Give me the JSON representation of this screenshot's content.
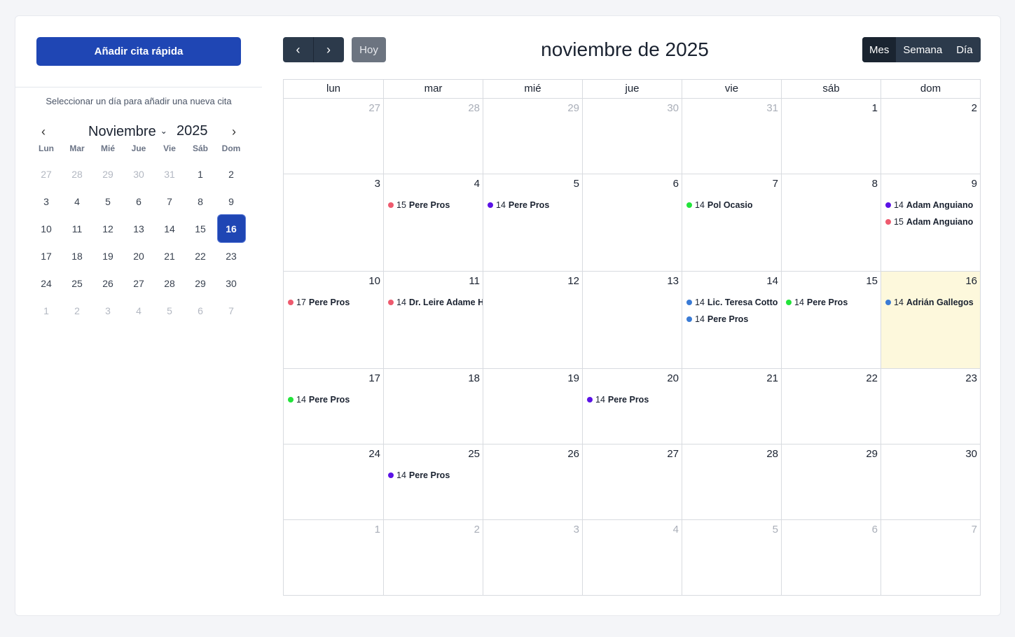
{
  "sidebar": {
    "quick_add_label": "Añadir cita rápida",
    "hint": "Seleccionar un día para añadir una nueva cita",
    "mini_calendar": {
      "month": "Noviembre",
      "year": "2025",
      "prev_icon": "chevron-left-icon",
      "next_icon": "chevron-right-icon",
      "weekdays": [
        "Lun",
        "Mar",
        "Mié",
        "Jue",
        "Vie",
        "Sáb",
        "Dom"
      ],
      "selected_day": "16",
      "days": [
        {
          "d": "27",
          "muted": true
        },
        {
          "d": "28",
          "muted": true
        },
        {
          "d": "29",
          "muted": true
        },
        {
          "d": "30",
          "muted": true
        },
        {
          "d": "31",
          "muted": true
        },
        {
          "d": "1"
        },
        {
          "d": "2"
        },
        {
          "d": "3"
        },
        {
          "d": "4"
        },
        {
          "d": "5"
        },
        {
          "d": "6"
        },
        {
          "d": "7"
        },
        {
          "d": "8"
        },
        {
          "d": "9"
        },
        {
          "d": "10"
        },
        {
          "d": "11"
        },
        {
          "d": "12"
        },
        {
          "d": "13"
        },
        {
          "d": "14"
        },
        {
          "d": "15"
        },
        {
          "d": "16",
          "selected": true
        },
        {
          "d": "17"
        },
        {
          "d": "18"
        },
        {
          "d": "19"
        },
        {
          "d": "20"
        },
        {
          "d": "21"
        },
        {
          "d": "22"
        },
        {
          "d": "23"
        },
        {
          "d": "24"
        },
        {
          "d": "25"
        },
        {
          "d": "26"
        },
        {
          "d": "27"
        },
        {
          "d": "28"
        },
        {
          "d": "29"
        },
        {
          "d": "30"
        },
        {
          "d": "1",
          "muted": true
        },
        {
          "d": "2",
          "muted": true
        },
        {
          "d": "3",
          "muted": true
        },
        {
          "d": "4",
          "muted": true
        },
        {
          "d": "5",
          "muted": true
        },
        {
          "d": "6",
          "muted": true
        },
        {
          "d": "7",
          "muted": true
        }
      ]
    }
  },
  "toolbar": {
    "prev_icon": "chevron-left-icon",
    "next_icon": "chevron-right-icon",
    "today_label": "Hoy",
    "title": "noviembre de 2025",
    "views": [
      {
        "label": "Mes",
        "active": true
      },
      {
        "label": "Semana"
      },
      {
        "label": "Día"
      }
    ]
  },
  "month": {
    "weekdays": [
      "lun",
      "mar",
      "mié",
      "jue",
      "vie",
      "sáb",
      "dom"
    ],
    "weeks": [
      [
        {
          "d": "27",
          "muted": true,
          "events": []
        },
        {
          "d": "28",
          "muted": true,
          "events": []
        },
        {
          "d": "29",
          "muted": true,
          "events": []
        },
        {
          "d": "30",
          "muted": true,
          "events": []
        },
        {
          "d": "31",
          "muted": true,
          "events": []
        },
        {
          "d": "1",
          "events": []
        },
        {
          "d": "2",
          "events": []
        }
      ],
      [
        {
          "d": "3",
          "events": []
        },
        {
          "d": "4",
          "events": [
            {
              "time": "15",
              "name": "Pere Pros",
              "color": "#ee5a6e"
            }
          ]
        },
        {
          "d": "5",
          "events": [
            {
              "time": "14",
              "name": "Pere Pros",
              "color": "#5b12e6"
            }
          ]
        },
        {
          "d": "6",
          "events": []
        },
        {
          "d": "7",
          "events": [
            {
              "time": "14",
              "name": "Pol Ocasio",
              "color": "#22e43a"
            }
          ]
        },
        {
          "d": "8",
          "events": []
        },
        {
          "d": "9",
          "events": [
            {
              "time": "14",
              "name": "Adam Anguiano",
              "color": "#5b12e6"
            },
            {
              "time": "15",
              "name": "Adam Anguiano",
              "color": "#ee5a6e"
            }
          ]
        }
      ],
      [
        {
          "d": "10",
          "events": [
            {
              "time": "17",
              "name": "Pere Pros",
              "color": "#ee5a6e"
            }
          ]
        },
        {
          "d": "11",
          "events": [
            {
              "time": "14",
              "name": "Dr. Leire Adame H",
              "color": "#ee5a6e"
            }
          ]
        },
        {
          "d": "12",
          "events": []
        },
        {
          "d": "13",
          "events": []
        },
        {
          "d": "14",
          "events": [
            {
              "time": "14",
              "name": "Lic. Teresa Cotto",
              "color": "#3a7bd5"
            },
            {
              "time": "14",
              "name": "Pere Pros",
              "color": "#3a7bd5"
            }
          ]
        },
        {
          "d": "15",
          "events": [
            {
              "time": "14",
              "name": "Pere Pros",
              "color": "#22e43a"
            }
          ]
        },
        {
          "d": "16",
          "today": true,
          "events": [
            {
              "time": "14",
              "name": "Adrián Gallegos",
              "color": "#3a7bd5"
            }
          ]
        }
      ],
      [
        {
          "d": "17",
          "events": [
            {
              "time": "14",
              "name": "Pere Pros",
              "color": "#22e43a"
            }
          ]
        },
        {
          "d": "18",
          "events": []
        },
        {
          "d": "19",
          "events": []
        },
        {
          "d": "20",
          "events": [
            {
              "time": "14",
              "name": "Pere Pros",
              "color": "#5b12e6"
            }
          ]
        },
        {
          "d": "21",
          "events": []
        },
        {
          "d": "22",
          "events": []
        },
        {
          "d": "23",
          "events": []
        }
      ],
      [
        {
          "d": "24",
          "events": []
        },
        {
          "d": "25",
          "events": [
            {
              "time": "14",
              "name": "Pere Pros",
              "color": "#5b12e6"
            }
          ]
        },
        {
          "d": "26",
          "events": []
        },
        {
          "d": "27",
          "events": []
        },
        {
          "d": "28",
          "events": []
        },
        {
          "d": "29",
          "events": []
        },
        {
          "d": "30",
          "events": []
        }
      ],
      [
        {
          "d": "1",
          "muted": true,
          "events": []
        },
        {
          "d": "2",
          "muted": true,
          "events": []
        },
        {
          "d": "3",
          "muted": true,
          "events": []
        },
        {
          "d": "4",
          "muted": true,
          "events": []
        },
        {
          "d": "5",
          "muted": true,
          "events": []
        },
        {
          "d": "6",
          "muted": true,
          "events": []
        },
        {
          "d": "7",
          "muted": true,
          "events": []
        }
      ]
    ]
  },
  "colors": {
    "primary": "#1f46b4",
    "toolbar_dark": "#2c3a4b",
    "today_bg": "#fdf8dc"
  }
}
